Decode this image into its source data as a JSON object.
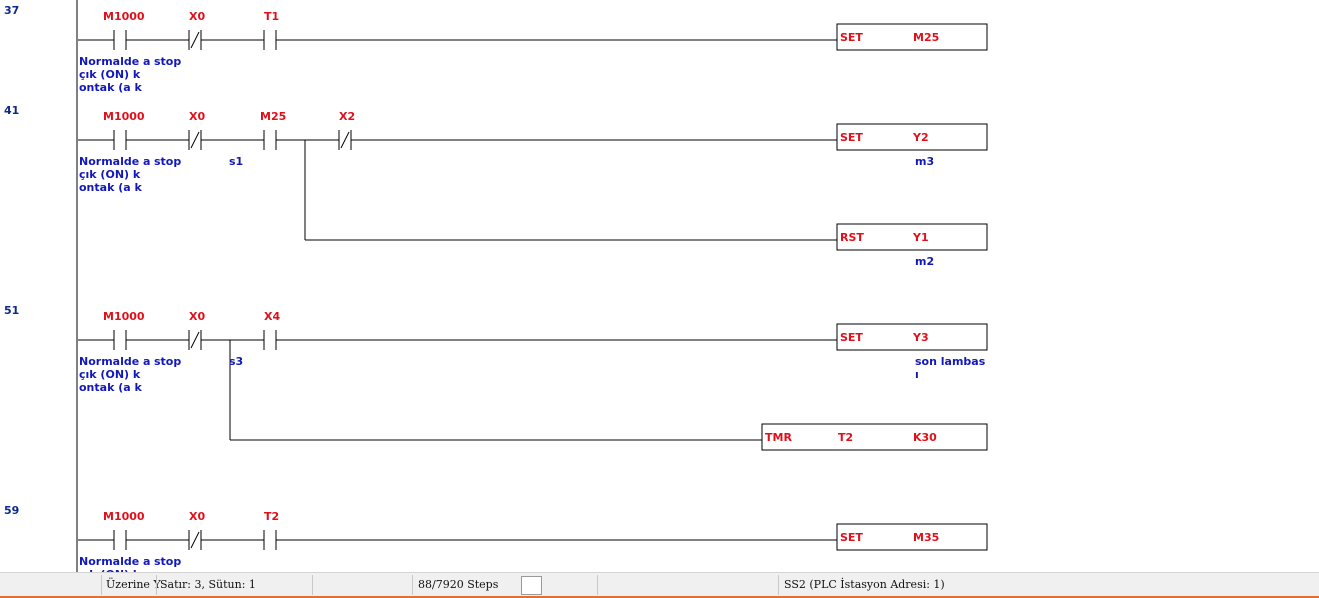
{
  "rungs": [
    {
      "step": "37",
      "contacts": [
        {
          "device": "M1000",
          "kind": "no",
          "comment": "Normalde a\nçık (ON) k\nontak (a k"
        },
        {
          "device": "X0",
          "kind": "nc",
          "comment": "stop"
        },
        {
          "device": "T1",
          "kind": "no",
          "comment": ""
        }
      ],
      "outputs": [
        {
          "instruction": "SET",
          "operands": [
            "M25"
          ],
          "comment": ""
        }
      ]
    },
    {
      "step": "41",
      "contacts": [
        {
          "device": "M1000",
          "kind": "no",
          "comment": "Normalde a\nçık (ON) k\nontak (a k"
        },
        {
          "device": "X0",
          "kind": "nc",
          "comment": "stop"
        },
        {
          "device": "M25",
          "kind": "no",
          "comment": "s1"
        },
        {
          "device": "X2",
          "kind": "nc",
          "comment": ""
        }
      ],
      "outputs": [
        {
          "instruction": "SET",
          "operands": [
            "Y2"
          ],
          "comment": "m3"
        },
        {
          "instruction": "RST",
          "operands": [
            "Y1"
          ],
          "comment": "m2"
        }
      ]
    },
    {
      "step": "51",
      "contacts": [
        {
          "device": "M1000",
          "kind": "no",
          "comment": "Normalde a\nçık (ON) k\nontak (a k"
        },
        {
          "device": "X0",
          "kind": "nc",
          "comment": "stop"
        },
        {
          "device": "X4",
          "kind": "no",
          "comment": "s3"
        }
      ],
      "outputs": [
        {
          "instruction": "SET",
          "operands": [
            "Y3"
          ],
          "comment": "son lambas\nı"
        },
        {
          "instruction": "TMR",
          "operands": [
            "T2",
            "K30"
          ],
          "comment": ""
        }
      ]
    },
    {
      "step": "59",
      "contacts": [
        {
          "device": "M1000",
          "kind": "no",
          "comment": "Normalde a\nçık (ON) k"
        },
        {
          "device": "X0",
          "kind": "nc",
          "comment": "stop"
        },
        {
          "device": "T2",
          "kind": "no",
          "comment": ""
        }
      ],
      "outputs": [
        {
          "instruction": "SET",
          "operands": [
            "M35"
          ],
          "comment": ""
        }
      ]
    }
  ],
  "statusbar": {
    "mode": "Üzerine Y",
    "position": "Satır: 3, Sütun: 1",
    "steps": "88/7920 Steps",
    "station": "SS2 (PLC İstasyon Adresi: 1)"
  },
  "colors": {
    "wire": "#000000",
    "device": "#e0101a",
    "comment": "#1218b8",
    "step": "#0b2a8a",
    "statusbar_bg": "#f0f0f0",
    "statusbar_bottom": "#e07030"
  }
}
